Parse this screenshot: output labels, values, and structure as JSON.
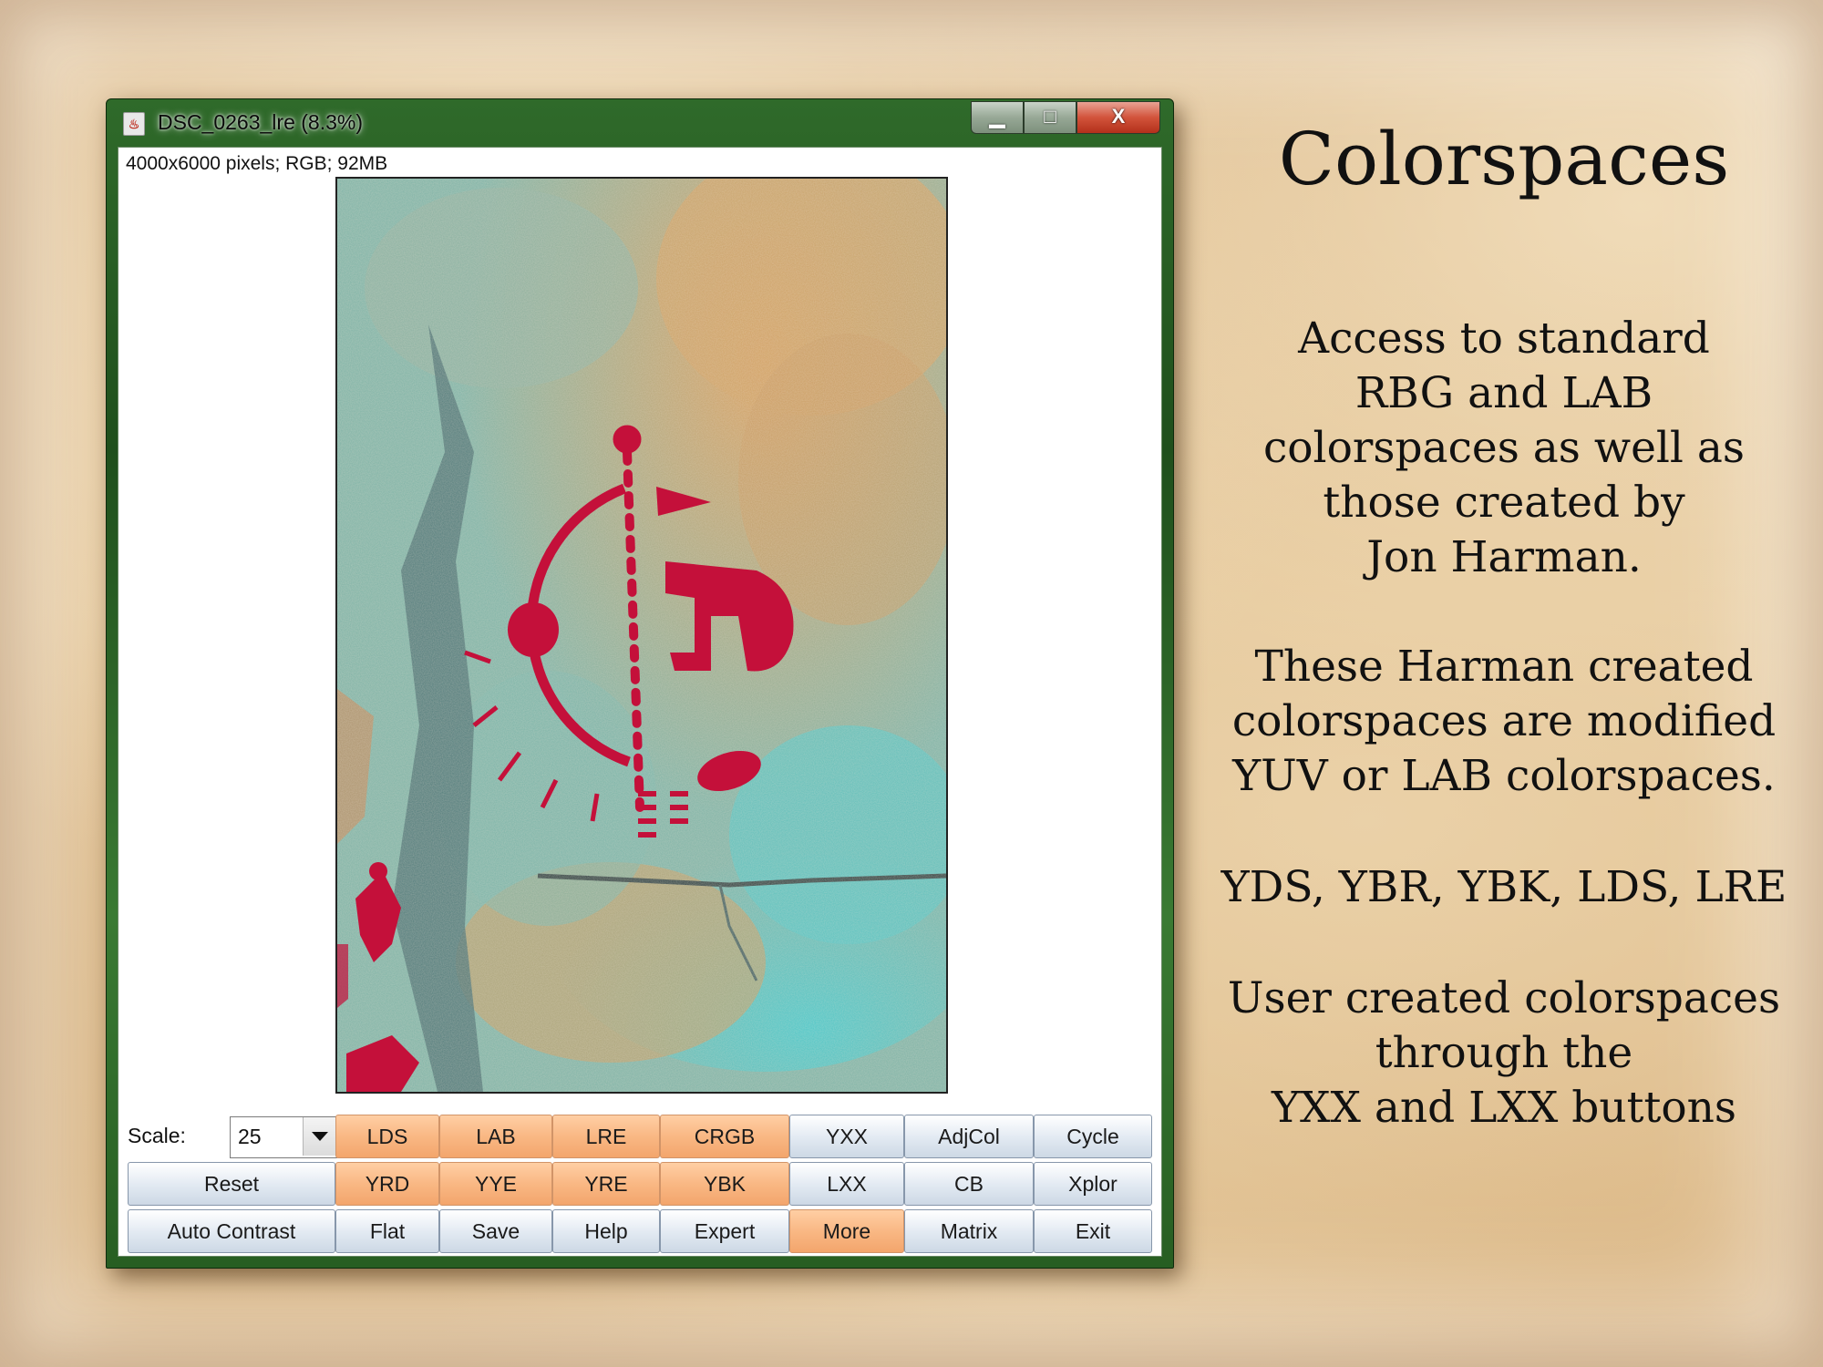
{
  "window": {
    "title": "DSC_0263_lre (8.3%)",
    "info": "4000x6000 pixels; RGB; 92MB",
    "controls": {
      "minimize": "▁",
      "maximize": "□",
      "close": "X"
    }
  },
  "toolbar": {
    "scale_label": "Scale:",
    "scale_value": "25",
    "buttons": {
      "lds": "LDS",
      "lab": "LAB",
      "lre": "LRE",
      "crgb": "CRGB",
      "yxx": "YXX",
      "adjcol": "AdjCol",
      "cycle": "Cycle",
      "reset": "Reset",
      "yrd": "YRD",
      "yye": "YYE",
      "yre": "YRE",
      "ybk": "YBK",
      "lxx": "LXX",
      "cb": "CB",
      "xplor": "Xplor",
      "auto_contrast": "Auto Contrast",
      "flat": "Flat",
      "save": "Save",
      "help": "Help",
      "expert": "Expert",
      "more": "More",
      "matrix": "Matrix",
      "exit": "Exit"
    },
    "highlight_color": "#f9b884"
  },
  "panel": {
    "heading": "Colorspaces",
    "p1": [
      "Access to standard",
      "RBG and LAB",
      "colorspaces as well as",
      "those created by",
      "Jon Harman."
    ],
    "p2": [
      "These Harman created",
      "colorspaces are modified",
      "YUV or LAB colorspaces."
    ],
    "p3": [
      "YDS, YBR, YBK, LDS, LRE"
    ],
    "p4": [
      "User created colorspaces",
      "through the",
      "YXX and LXX buttons"
    ]
  }
}
